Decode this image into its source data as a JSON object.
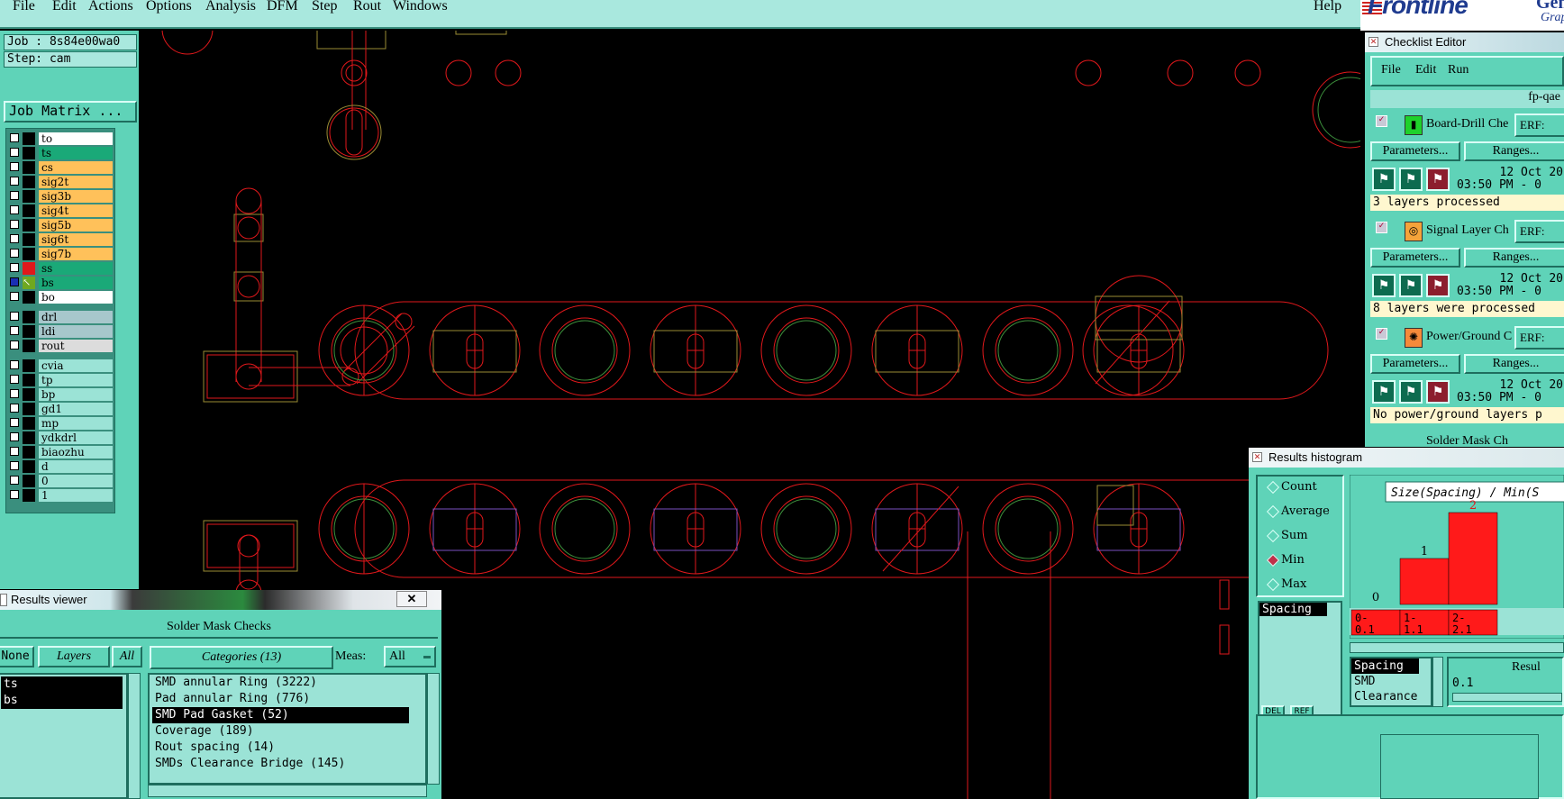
{
  "menu": {
    "items": [
      "File",
      "Edit",
      "Actions",
      "Options",
      "Analysis",
      "DFM",
      "Step",
      "Rout",
      "Windows"
    ],
    "help": "Help"
  },
  "logo": {
    "brand": "Frontline",
    "gen": "Gene",
    "sub": "Graph"
  },
  "job": {
    "job_label": "Job : 8s84e00wa0",
    "step_label": "Step: cam",
    "job_matrix": "Job Matrix ..."
  },
  "layers": [
    {
      "name": "to",
      "color": "#ffffff",
      "on": false
    },
    {
      "name": "ts",
      "color": "#1aa978",
      "on": false
    },
    {
      "name": "cs",
      "color": "#ffc15a",
      "on": false
    },
    {
      "name": "sig2t",
      "color": "#ffc15a",
      "on": false
    },
    {
      "name": "sig3b",
      "color": "#ffc15a",
      "on": false
    },
    {
      "name": "sig4t",
      "color": "#ffc15a",
      "on": false
    },
    {
      "name": "sig5b",
      "color": "#ffc15a",
      "on": false
    },
    {
      "name": "sig6t",
      "color": "#ffc15a",
      "on": false
    },
    {
      "name": "sig7b",
      "color": "#ffc15a",
      "on": false
    },
    {
      "name": "ss",
      "color": "#1aa978",
      "on": false
    },
    {
      "name": "bs",
      "color": "#1aa978",
      "on": true
    },
    {
      "name": "bo",
      "color": "#ffffff",
      "on": false
    },
    {
      "name": "drl",
      "color": "#a7c7cc",
      "on": false
    },
    {
      "name": "ldi",
      "color": "#a7c7cc",
      "on": false
    },
    {
      "name": "rout",
      "color": "#dcdcdc",
      "on": false
    },
    {
      "name": "cvia",
      "color": "#9be3d6",
      "on": false
    },
    {
      "name": "tp",
      "color": "#9be3d6",
      "on": false
    },
    {
      "name": "bp",
      "color": "#9be3d6",
      "on": false
    },
    {
      "name": "gd1",
      "color": "#9be3d6",
      "on": false
    },
    {
      "name": "mp",
      "color": "#9be3d6",
      "on": false
    },
    {
      "name": "ydkdrl",
      "color": "#9be3d6",
      "on": false
    },
    {
      "name": "biaozhu",
      "color": "#9be3d6",
      "on": false
    },
    {
      "name": "d",
      "color": "#9be3d6",
      "on": false
    },
    {
      "name": "0",
      "color": "#9be3d6",
      "on": false
    },
    {
      "name": "1",
      "color": "#9be3d6",
      "on": false
    }
  ],
  "checklist": {
    "title": "Checklist Editor",
    "menu": [
      "File",
      "Edit",
      "Run"
    ],
    "name": "fp-qae",
    "erf": "ERF:",
    "parameters": "Parameters...",
    "ranges": "Ranges...",
    "checks": [
      {
        "title": "Board-Drill Che",
        "date": "12 Oct 20",
        "time": "03:50 PM - 0",
        "status": "3 layers processed"
      },
      {
        "title": "Signal Layer Ch",
        "date": "12 Oct 20",
        "time": "03:50 PM - 0",
        "status": "8 layers were processed"
      },
      {
        "title": "Power/Ground C",
        "date": "12 Oct 20",
        "time": "03:50 PM - 0",
        "status": "No power/ground layers p"
      }
    ],
    "partial": "Solder Mask Ch"
  },
  "results_viewer": {
    "title": "Results viewer",
    "header": "Solder Mask Checks",
    "none": "None",
    "layers": "Layers",
    "all": "All",
    "categories_btn": "Categories (13)",
    "meas_label": "Meas:",
    "meas_value": "All",
    "layer_list": [
      "ts",
      "bs"
    ],
    "categories": [
      "SMD annular Ring (3222)",
      "Pad annular Ring (776)",
      "SMD Pad Gasket (52)",
      "Coverage (189)",
      "Rout spacing (14)",
      "SMDs Clearance Bridge (145)"
    ],
    "selected_index": 2
  },
  "histogram": {
    "title": "Results histogram",
    "modes": [
      "Count",
      "Average",
      "Sum",
      "Min",
      "Max"
    ],
    "selected_mode": "Min",
    "measure": "Spacing",
    "chart_title": "Size(Spacing) / Min(S",
    "bins": [
      {
        "label": "0-\n  0.1",
        "value": 0
      },
      {
        "label": "1-\n  1.1",
        "value": 1
      },
      {
        "label": "2-\n  2.1",
        "value": 2
      }
    ],
    "legend": [
      "Spacing",
      "SMD",
      "Clearance"
    ],
    "results_label": "Resul",
    "value": "0.1",
    "del": "DEL",
    "ref": "REF"
  },
  "colors": {
    "panel": "#5fd3b8",
    "light": "#9be3d6",
    "board_red": "#e0181b",
    "board_olive": "#9a8b33",
    "board_green": "#3c8f3c",
    "bar": "#ff1a1a"
  }
}
